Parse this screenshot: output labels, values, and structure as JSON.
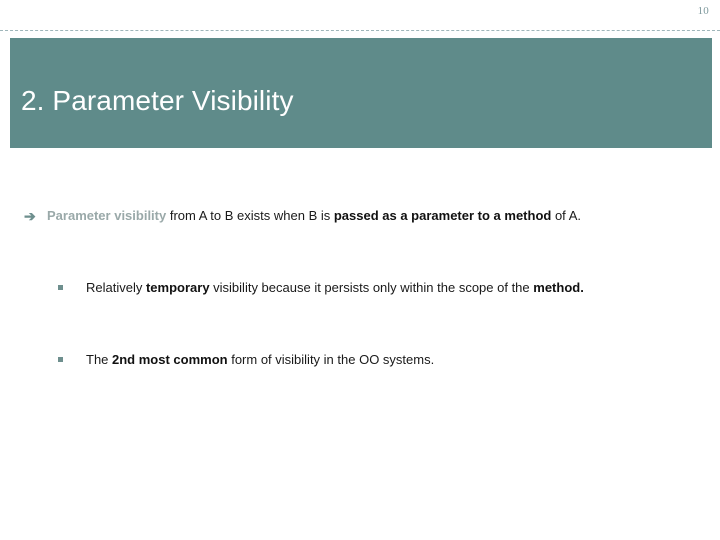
{
  "slide": {
    "page_number": "10",
    "title": "2. Parameter Visibility",
    "accent_color": "#5f8b8a",
    "accent_text_color": "#9aa9a9",
    "body_text_color": "#1a1a1a",
    "banner_text_color": "#ffffff",
    "page_number_color": "#7f9a9e"
  },
  "bullets": {
    "level1": {
      "marker": "arrow-right-icon",
      "marker_glyph": "➔",
      "runs": {
        "r1": "Parameter visibility",
        "r2": " from A to B exists when B is ",
        "r3": "passed as a parameter to a method",
        "r4": " of A."
      },
      "full_text": "Parameter visibility from A to B exists when B is passed as a parameter to a method of A."
    },
    "level2": [
      {
        "marker": "square-bullet-icon",
        "runs": {
          "r1": "Relatively ",
          "r2": "temporary",
          "r3": " visibility because it persists only within the scope of the ",
          "r4": "method."
        },
        "full_text": "Relatively temporary visibility because it persists only within the scope of the method."
      },
      {
        "marker": "square-bullet-icon",
        "runs": {
          "r1": "The ",
          "r2": "2nd most common",
          "r3": " form of visibility in the OO systems.",
          "r4": ""
        },
        "full_text": "The 2nd most common form of visibility in the OO systems."
      }
    ]
  }
}
